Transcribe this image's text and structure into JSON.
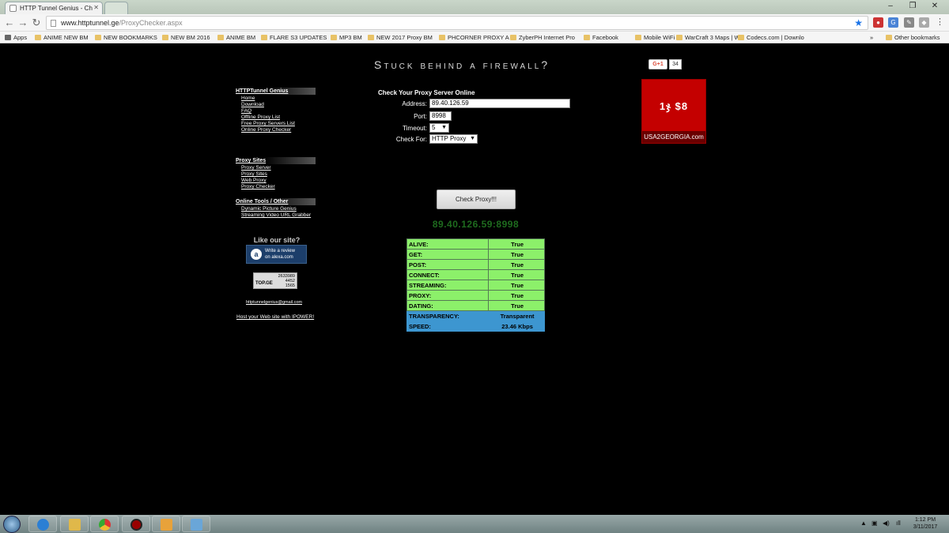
{
  "browser": {
    "tab_title": "HTTP Tunnel Genius - Ch",
    "url_domain": "www.httptunnel.ge",
    "url_path": "/ProxyChecker.aspx",
    "bookmarks": [
      "Apps",
      "ANIME NEW BM",
      "NEW BOOKMARKS",
      "NEW BM 2016",
      "ANIME BM",
      "FLARE S3 UPDATES",
      "MP3 BM",
      "NEW 2017 Proxy BM",
      "PHCORNER PROXY A",
      "ZyberPH Internet Pro",
      "Facebook",
      "Mobile WiFi",
      "WarCraft 3 Maps | W",
      "Codecs.com | Downlo",
      "»",
      "Other bookmarks"
    ]
  },
  "page": {
    "headline": "Stuck behind a firewall?",
    "gplus_label": "G+1",
    "gplus_count": "34",
    "ad_big": "1ჯ $8",
    "ad_site": "USA2GEORGIA.com"
  },
  "sidebar": {
    "sections": [
      {
        "title": "HTTPTunnel Genius",
        "links": [
          "Home",
          "Download",
          "FAQ",
          "Offline Proxy List",
          "Free Proxy Servers List",
          "Online Proxy Checker"
        ]
      },
      {
        "title": "Proxy Sites",
        "links": [
          "Proxy Server",
          "Proxy Sites",
          "Web Proxy",
          "Proxy Checker"
        ]
      },
      {
        "title": "Online Tools / Other",
        "links": [
          "Dynamic Picture Genius",
          "Streaming Video URL Grabber"
        ]
      }
    ],
    "like_site": "Like our site?",
    "alexa_line1": "Write a review",
    "alexa_line2": "on alexa.com",
    "topge_label": "TOP.GE",
    "topge_nums": [
      "2633989",
      "4452",
      "1565"
    ],
    "email": "httptunnelgenius@gmail.com",
    "host": "Host your Web site with IPOWER!"
  },
  "form": {
    "title": "Check Your Proxy Server Online",
    "address_label": "Address:",
    "address_value": "89.40.126.59",
    "port_label": "Port:",
    "port_value": "8998",
    "timeout_label": "Timeout:",
    "timeout_value": "5",
    "checkfor_label": "Check For:",
    "checkfor_value": "HTTP Proxy",
    "button": "Check Proxy!!!"
  },
  "result": {
    "proxy": "89.40.126.59:8998",
    "rows": [
      {
        "label": "ALIVE:",
        "value": "True"
      },
      {
        "label": "GET:",
        "value": "True"
      },
      {
        "label": "POST:",
        "value": "True"
      },
      {
        "label": "CONNECT:",
        "value": "True"
      },
      {
        "label": "STREAMING:",
        "value": "True"
      },
      {
        "label": "PROXY:",
        "value": "True"
      },
      {
        "label": "DATING:",
        "value": "True"
      },
      {
        "label": "TRANSPARENCY:",
        "value": "Transparent"
      },
      {
        "label": "SPEED:",
        "value": "23.46 Kbps"
      }
    ]
  },
  "taskbar": {
    "time": "1:12 PM",
    "date": "3/11/2017"
  }
}
